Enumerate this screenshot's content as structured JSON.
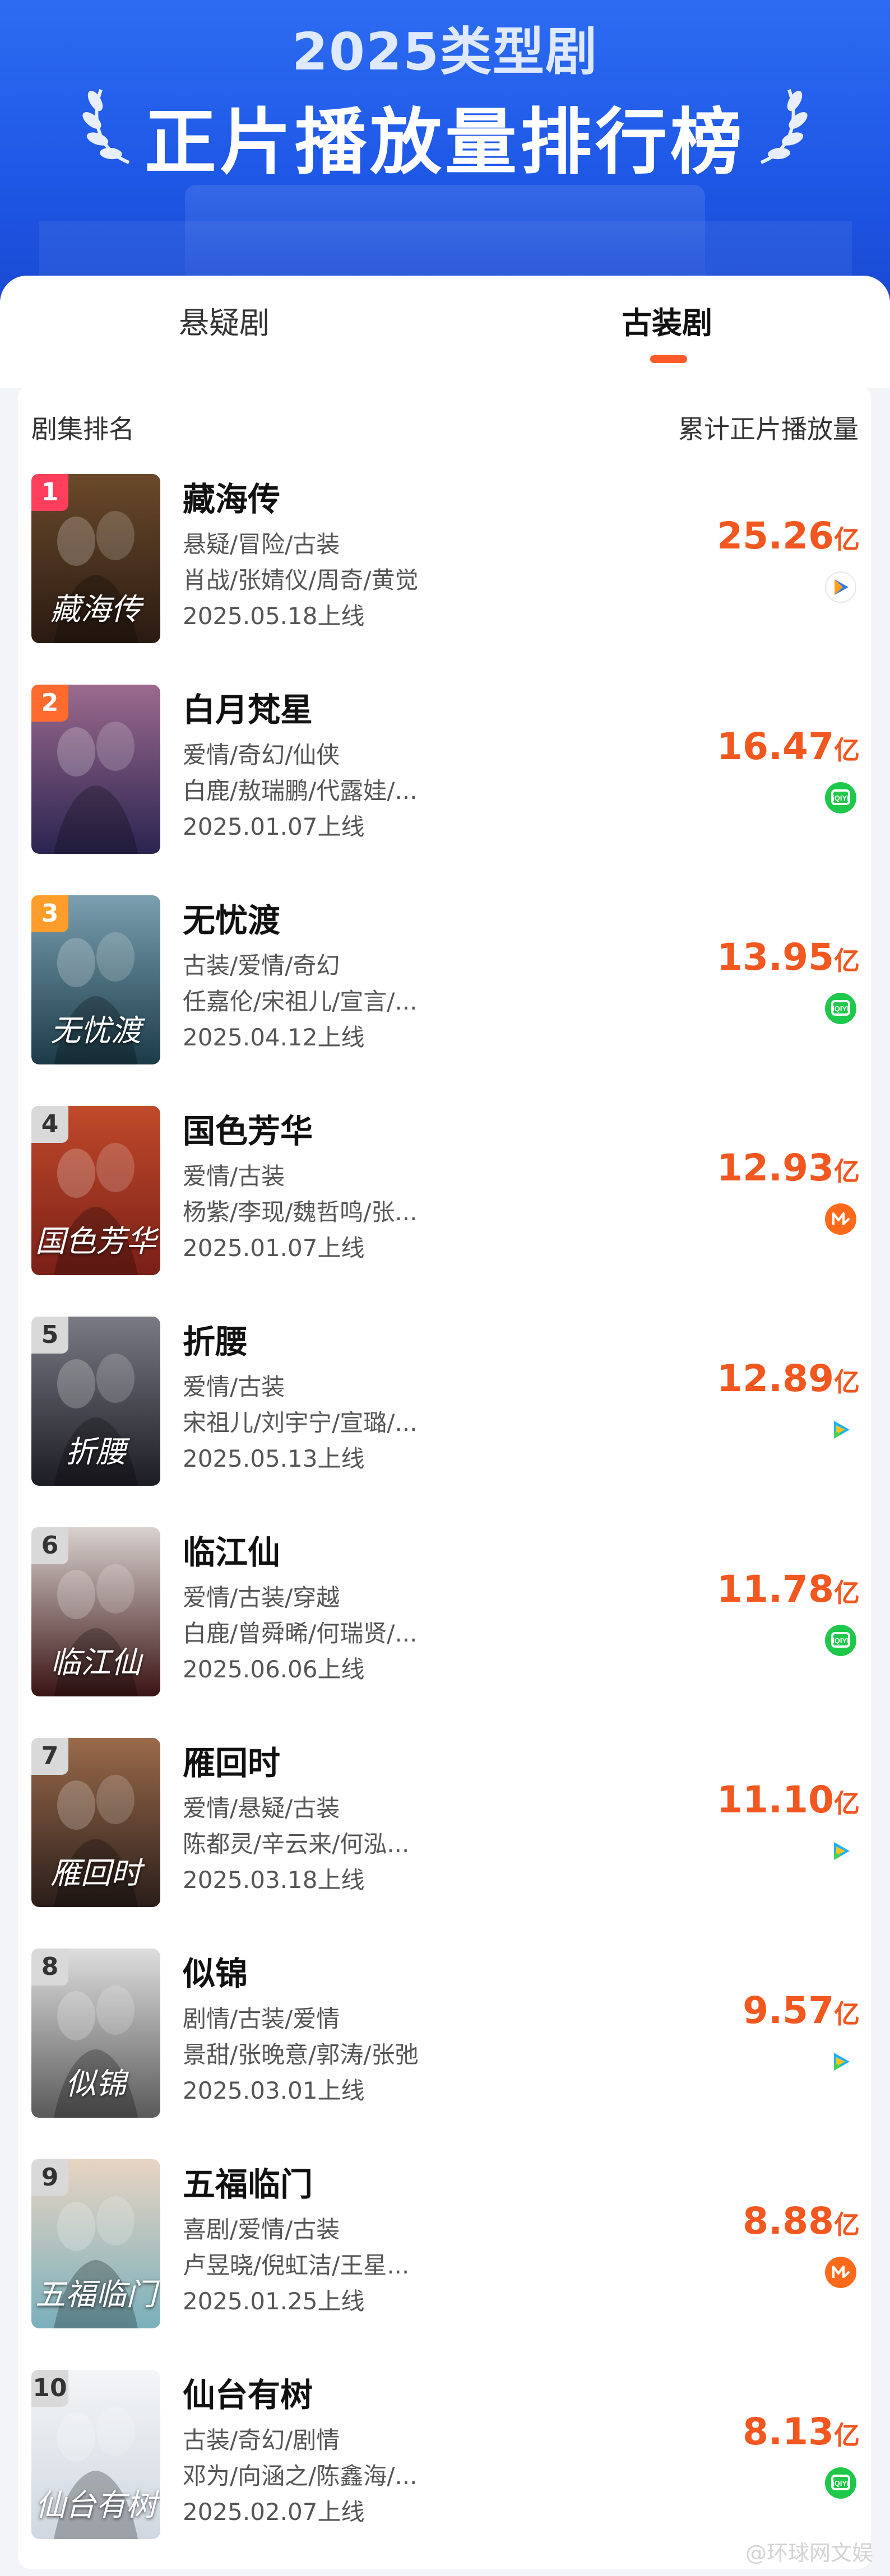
{
  "banner": {
    "title_line1": "2025类型剧",
    "title_line2": "正片播放量排行榜"
  },
  "tabs": [
    {
      "label": "悬疑剧",
      "active": false
    },
    {
      "label": "古装剧",
      "active": true
    }
  ],
  "accent_color": "#f2571f",
  "list_header": {
    "left": "剧集排名",
    "right": "累计正片播放量"
  },
  "items": [
    {
      "rank": "1",
      "title": "藏海传",
      "genre": "悬疑/冒险/古装",
      "cast": "肖战/张婧仪/周奇/黄觉",
      "date": "2025.05.18上线",
      "views": "25.26",
      "unit": "亿",
      "platform": "youku-icon",
      "poster_text": "藏海传"
    },
    {
      "rank": "2",
      "title": "白月梵星",
      "genre": "爱情/奇幻/仙侠",
      "cast": "白鹿/敖瑞鹏/代露娃/...",
      "date": "2025.01.07上线",
      "views": "16.47",
      "unit": "亿",
      "platform": "iqiyi-icon",
      "poster_text": ""
    },
    {
      "rank": "3",
      "title": "无忧渡",
      "genre": "古装/爱情/奇幻",
      "cast": "任嘉伦/宋祖儿/宣言/...",
      "date": "2025.04.12上线",
      "views": "13.95",
      "unit": "亿",
      "platform": "iqiyi-icon",
      "poster_text": "无忧渡"
    },
    {
      "rank": "4",
      "title": "国色芳华",
      "genre": "爱情/古装",
      "cast": "杨紫/李现/魏哲鸣/张...",
      "date": "2025.01.07上线",
      "views": "12.93",
      "unit": "亿",
      "platform": "mgtv-icon",
      "poster_text": "国色芳华"
    },
    {
      "rank": "5",
      "title": "折腰",
      "genre": "爱情/古装",
      "cast": "宋祖儿/刘宇宁/宣璐/...",
      "date": "2025.05.13上线",
      "views": "12.89",
      "unit": "亿",
      "platform": "tencent-video-icon",
      "poster_text": "折腰"
    },
    {
      "rank": "6",
      "title": "临江仙",
      "genre": "爱情/古装/穿越",
      "cast": "白鹿/曾舜晞/何瑞贤/...",
      "date": "2025.06.06上线",
      "views": "11.78",
      "unit": "亿",
      "platform": "iqiyi-icon",
      "poster_text": "临江仙"
    },
    {
      "rank": "7",
      "title": "雁回时",
      "genre": "爱情/悬疑/古装",
      "cast": "陈都灵/辛云来/何泓...",
      "date": "2025.03.18上线",
      "views": "11.10",
      "unit": "亿",
      "platform": "tencent-video-icon",
      "poster_text": "雁回时"
    },
    {
      "rank": "8",
      "title": "似锦",
      "genre": "剧情/古装/爱情",
      "cast": "景甜/张晚意/郭涛/张弛",
      "date": "2025.03.01上线",
      "views": "9.57",
      "unit": "亿",
      "platform": "tencent-video-icon",
      "poster_text": "似锦"
    },
    {
      "rank": "9",
      "title": "五福临门",
      "genre": "喜剧/爱情/古装",
      "cast": "卢昱晓/倪虹洁/王星...",
      "date": "2025.01.25上线",
      "views": "8.88",
      "unit": "亿",
      "platform": "mgtv-icon",
      "poster_text": "五福临门"
    },
    {
      "rank": "10",
      "title": "仙台有树",
      "genre": "古装/奇幻/剧情",
      "cast": "邓为/向涵之/陈鑫海/...",
      "date": "2025.02.07上线",
      "views": "8.13",
      "unit": "亿",
      "platform": "iqiyi-icon",
      "poster_text": "仙台有树"
    }
  ],
  "watermark": "@环球网文娱"
}
